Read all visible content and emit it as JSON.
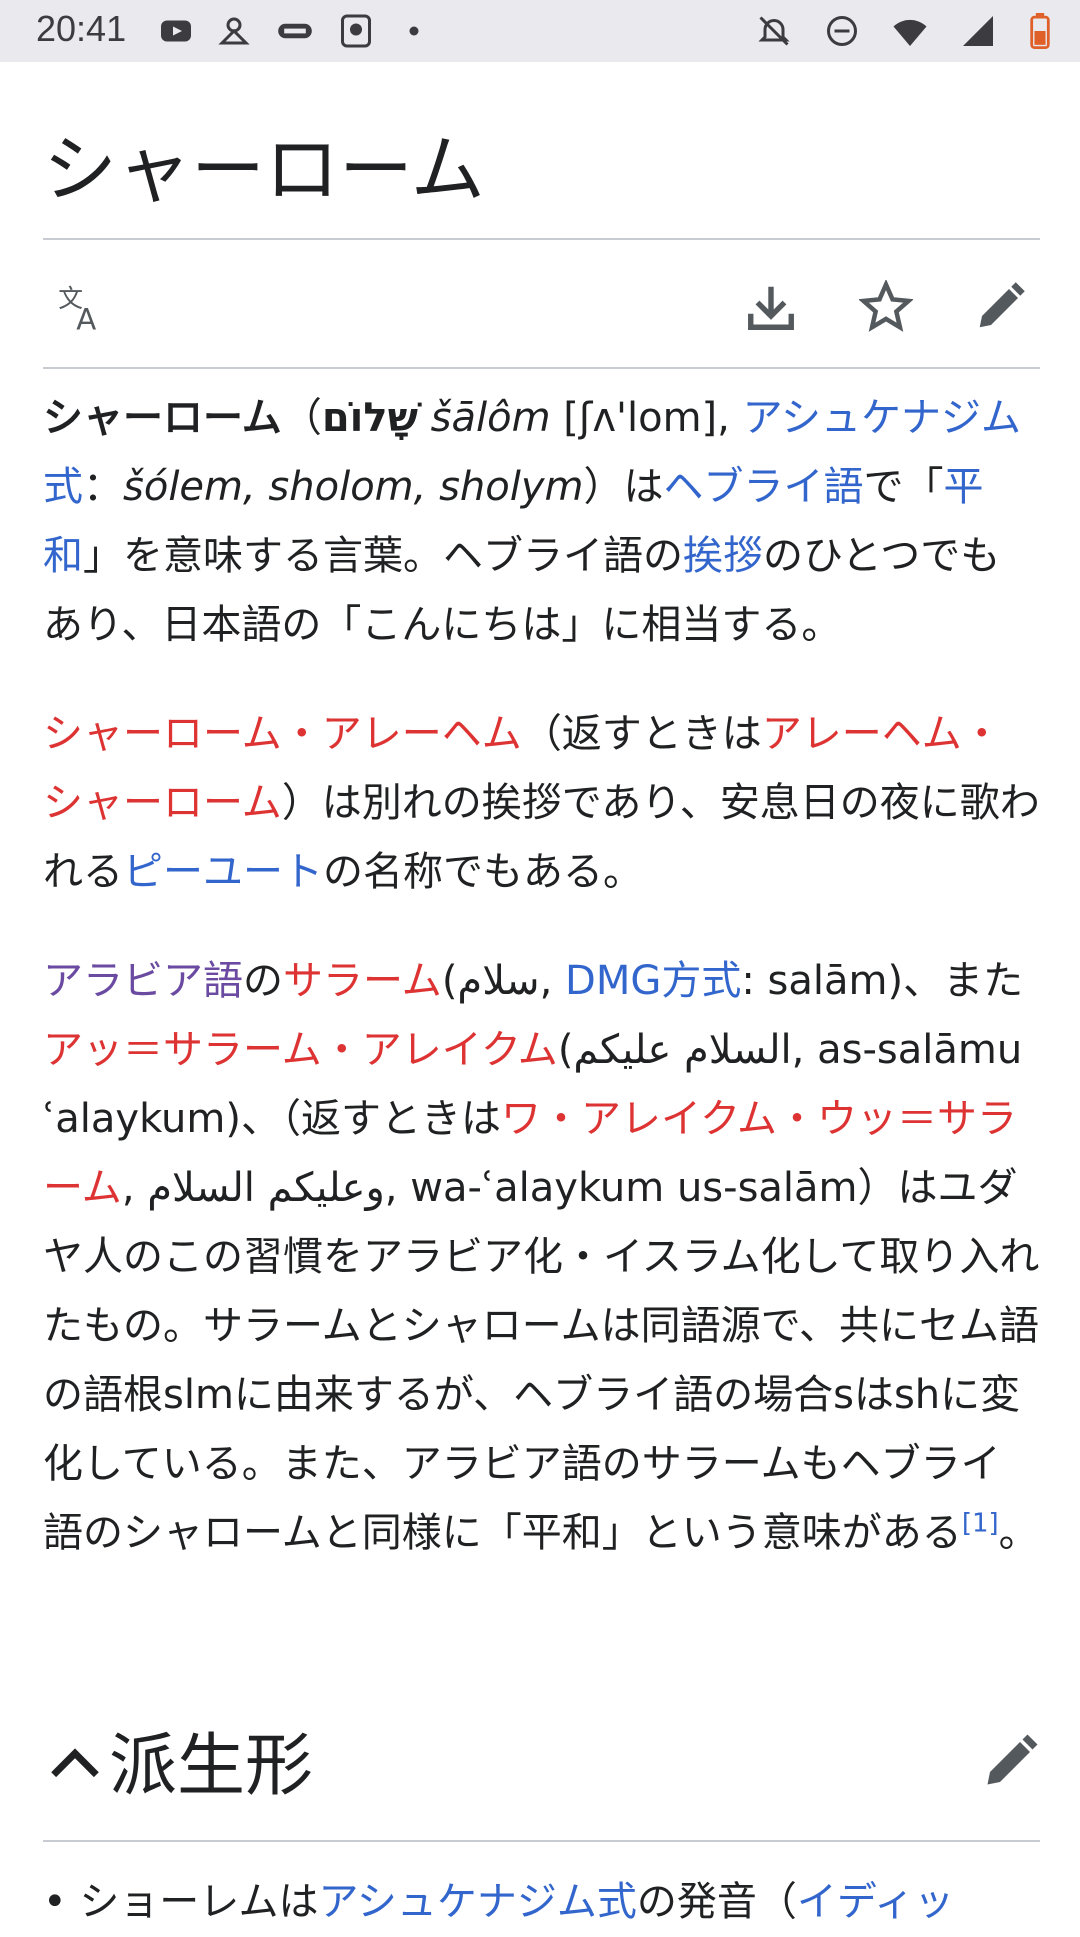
{
  "status_bar": {
    "time": "20:41",
    "left_icons": [
      "youtube-icon",
      "app-icon",
      "spoon-icon",
      "game-icon",
      "dot-icon"
    ],
    "right_icons": [
      "mute-icon",
      "dnd-icon",
      "wifi-icon",
      "signal-icon",
      "battery-icon"
    ]
  },
  "page": {
    "title": "シャーローム"
  },
  "toolbar": {
    "language_icon": "translate-icon",
    "download_icon": "download-icon",
    "star_icon": "star-icon",
    "edit_icon": "pencil-icon"
  },
  "paragraphs": {
    "p1": {
      "bold": "シャーローム",
      "paren_open": "（",
      "hebrew": "שָׁלוֹם",
      "translit": " šālôm",
      "ipa": " [ʃʌ'lom], ",
      "link_ashkenazi": "アシュケナジム式",
      "colon": "：",
      "forms": "šólem, sholom, sholym",
      "t1": "）は",
      "link_hebrew": "ヘブライ語",
      "t2": "で「",
      "link_peace": "平和",
      "t3": "」を意味する言葉。ヘブライ語の",
      "link_greeting": "挨拶",
      "t4": "のひとつでもあり、日本語の「こんにちは」に相当する。"
    },
    "p2": {
      "link_aleichem": "シャーローム・アレーヘム",
      "t1": "（返すときは",
      "link_reply": "アレーヘム・シャーローム",
      "t2": "）は別れの挨拶であり、安息日の夜に歌われる",
      "link_piyyut": "ピーユート",
      "t3": "の名称でもある。"
    },
    "p3": {
      "link_arabic": "アラビア語",
      "t1": "の",
      "link_salam": "サラーム",
      "t2": "(سلام, ",
      "link_dmg": "DMG方式",
      "t3": ": salām)、また",
      "link_assalamu": "アッ＝サラーム・アレイクム",
      "t4": "(السلام عليكم, as-salāmu ʿalaykum)、（返すときは",
      "link_wa": "ワ・アレイクム・ウッ＝サラーム",
      "t5": ", وعليكم السلام, wa-ʿalaykum us-salām）はユダヤ人のこの習慣をアラビア化・イスラム化して取り入れたもの。サラームとシャロームは同語源で、共にセム語の語根slmに由来するが、ヘブライ語の場合sはshに変化している。また、アラビア語のサラームもヘブライ語のシャロームと同様に「平和」という意味がある",
      "ref": "[1]",
      "t6": "。"
    }
  },
  "section": {
    "title": "派生形",
    "chevron_icon": "chevron-up-icon",
    "edit_icon": "pencil-icon"
  },
  "bullet": {
    "t1": "ショーレムは",
    "link_ashkenazi": "アシュケナジム式",
    "t2": "の発音（",
    "link_yiddish": "イディッ"
  }
}
